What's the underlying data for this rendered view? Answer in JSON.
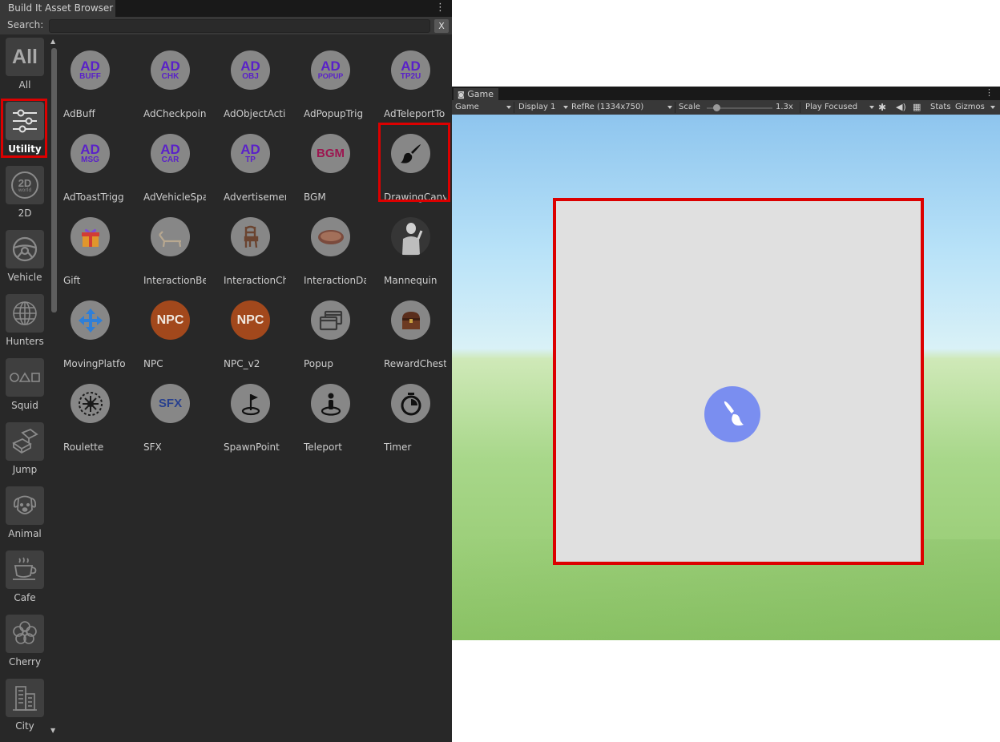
{
  "browser": {
    "title": "Build It Asset Browser",
    "menu_glyph": "⋮",
    "search": {
      "label": "Search:",
      "value": "",
      "placeholder": "",
      "clear_label": "X"
    },
    "categories": [
      {
        "label": "All",
        "icon": "all-text-icon",
        "icon_text": "All"
      },
      {
        "label": "Utility",
        "icon": "sliders-icon",
        "selected": true
      },
      {
        "label": "2D",
        "icon": "2d-world-icon",
        "icon_text": "2D",
        "icon_subtext": "world"
      },
      {
        "label": "Vehicle",
        "icon": "steering-wheel-icon"
      },
      {
        "label": "Hunters",
        "icon": "globe-grid-icon"
      },
      {
        "label": "Squid",
        "icon": "circle-triangle-square-icon"
      },
      {
        "label": "Jump",
        "icon": "jump-blocks-icon"
      },
      {
        "label": "Animal",
        "icon": "dog-icon"
      },
      {
        "label": "Cafe",
        "icon": "coffee-cup-icon"
      },
      {
        "label": "Cherry",
        "icon": "cherry-blossom-icon"
      },
      {
        "label": "City",
        "icon": "city-buildings-icon"
      }
    ],
    "assets": [
      {
        "label": "AdBuff",
        "icon_top": "AD",
        "icon_sub": "BUFF"
      },
      {
        "label": "AdCheckpoin",
        "icon_top": "AD",
        "icon_sub": "CHK"
      },
      {
        "label": "AdObjectActi",
        "icon_top": "AD",
        "icon_sub": "OBJ"
      },
      {
        "label": "AdPopupTrig",
        "icon_top": "AD",
        "icon_sub": "POPUP"
      },
      {
        "label": "AdTeleportTo",
        "icon_top": "AD",
        "icon_sub": "TP2U"
      },
      {
        "label": "AdToastTrigg",
        "icon_top": "AD",
        "icon_sub": "MSG"
      },
      {
        "label": "AdVehicleSpa",
        "icon_top": "AD",
        "icon_sub": "CAR"
      },
      {
        "label": "Advertisemen",
        "icon_top": "AD",
        "icon_sub": "TP"
      },
      {
        "label": "BGM",
        "icon_text": "BGM"
      },
      {
        "label": "DrawingCanv",
        "icon": "paint-brush-icon",
        "highlighted": true
      },
      {
        "label": "Gift",
        "icon": "gift-box-icon"
      },
      {
        "label": "InteractionBe",
        "icon": "lounge-chair-icon"
      },
      {
        "label": "InteractionCh",
        "icon": "wooden-chair-icon"
      },
      {
        "label": "InteractionDa",
        "icon": "dance-pad-icon"
      },
      {
        "label": "Mannequin",
        "icon": "mannequin-icon"
      },
      {
        "label": "MovingPlatfo",
        "icon": "move-arrows-icon"
      },
      {
        "label": "NPC",
        "icon_text": "NPC"
      },
      {
        "label": "NPC_v2",
        "icon_text": "NPC"
      },
      {
        "label": "Popup",
        "icon": "popup-windows-icon"
      },
      {
        "label": "RewardChest",
        "icon": "treasure-chest-icon"
      },
      {
        "label": "Roulette",
        "icon": "roulette-wheel-icon"
      },
      {
        "label": "SFX",
        "icon_text": "SFX"
      },
      {
        "label": "SpawnPoint",
        "icon": "flag-pin-icon"
      },
      {
        "label": "Teleport",
        "icon": "teleport-person-icon"
      },
      {
        "label": "Timer",
        "icon": "stopwatch-icon"
      }
    ]
  },
  "game": {
    "tab_label": "Game",
    "menu_glyph": "⋮",
    "toolbar": {
      "view_mode": "Game",
      "display": "Display 1",
      "resolution": "RefRe (1334x750)",
      "scale_label": "Scale",
      "scale_value": "1.3x",
      "play_mode": "Play Focused",
      "stats_label": "Stats",
      "gizmos_label": "Gizmos"
    },
    "canvas": {
      "icon": "paint-brush-icon"
    }
  },
  "colors": {
    "highlight_red": "#dc0000",
    "ad_purple": "#5a21c9",
    "npc_orange": "#a2481c",
    "brush_badge_blue": "#7a8ef0",
    "panel_bg": "#282828"
  }
}
